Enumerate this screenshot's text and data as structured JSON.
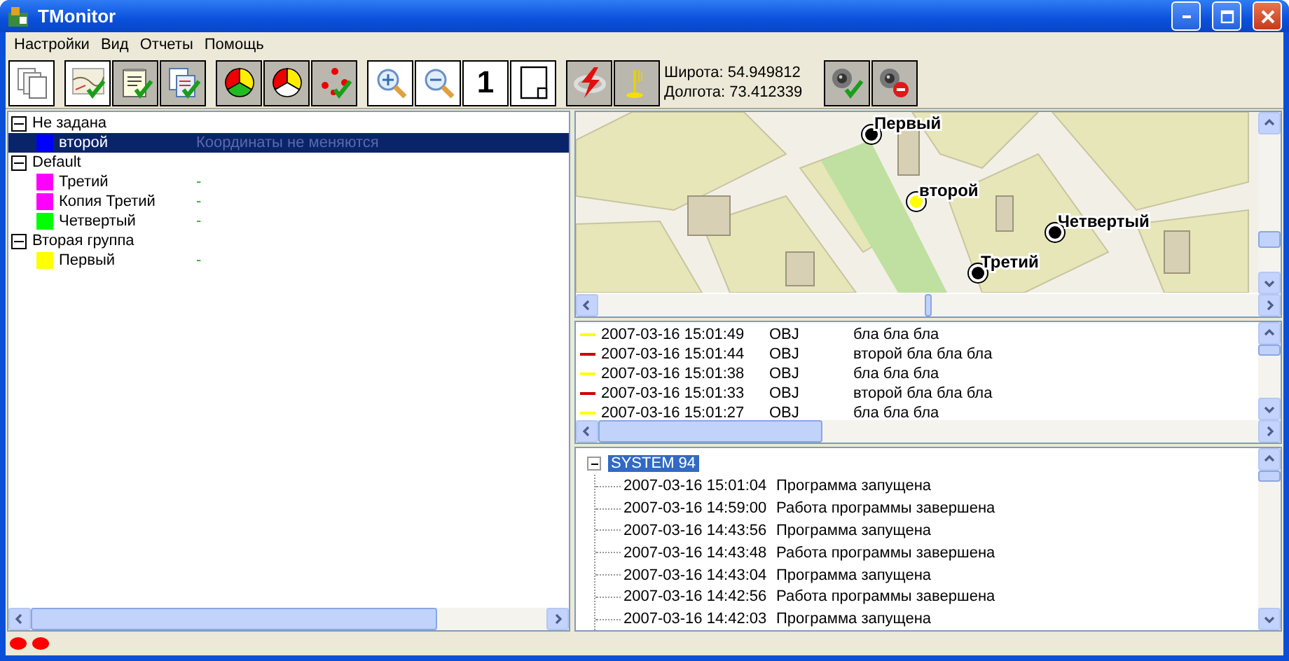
{
  "window": {
    "title": "TMonitor"
  },
  "menu": [
    "Настройки",
    "Вид",
    "Отчеты",
    "Помощь"
  ],
  "toolbar": [
    [
      {
        "kind": "copy",
        "pressed": false
      }
    ],
    [
      {
        "kind": "map-check",
        "pressed": false
      },
      {
        "kind": "notes-check",
        "pressed": true
      },
      {
        "kind": "docs-check",
        "pressed": true
      }
    ],
    [
      {
        "kind": "pie-green",
        "pressed": true
      },
      {
        "kind": "pie-white",
        "pressed": true
      },
      {
        "kind": "dots-check",
        "pressed": true
      }
    ],
    [
      {
        "kind": "zoom-in",
        "pressed": false
      },
      {
        "kind": "zoom-out",
        "pressed": false
      },
      {
        "kind": "number",
        "label": "1",
        "pressed": false
      },
      {
        "kind": "page",
        "pressed": false
      }
    ],
    [
      {
        "kind": "lightning",
        "pressed": true
      },
      {
        "kind": "antenna",
        "pressed": true
      },
      {
        "kind": "coords",
        "lines": [
          "Широта: 54.949812",
          "Долгота: 73.412339"
        ]
      }
    ],
    [
      {
        "kind": "camera-check",
        "pressed": true
      },
      {
        "kind": "camera-stop",
        "pressed": true
      }
    ]
  ],
  "objects_tree": [
    {
      "label": "Не задана",
      "expanded": true,
      "children": [
        {
          "label": "второй",
          "color": "#0000ff",
          "status": "Координаты не меняются",
          "selected": true
        }
      ]
    },
    {
      "label": "Default",
      "expanded": true,
      "children": [
        {
          "label": "Третий",
          "color": "#ff00ff",
          "status": "-",
          "selected": false
        },
        {
          "label": "Копия Третий",
          "color": "#ff00ff",
          "status": "-",
          "selected": false
        },
        {
          "label": "Четвертый",
          "color": "#00ff00",
          "status": "-",
          "selected": false
        }
      ]
    },
    {
      "label": "Вторая группа",
      "expanded": true,
      "children": [
        {
          "label": "Первый",
          "color": "#ffff00",
          "status": "-",
          "selected": false
        }
      ]
    }
  ],
  "map": {
    "markers": [
      {
        "label": "Первый",
        "color": "#000000"
      },
      {
        "label": "второй",
        "color": "#ffff00"
      },
      {
        "label": "Четвертый",
        "color": "#000000"
      },
      {
        "label": "Третий",
        "color": "#000000"
      }
    ]
  },
  "events": [
    {
      "color": "#ffff00",
      "time": "2007-03-16 15:01:49",
      "type": "OBJ",
      "text": "бла бла бла"
    },
    {
      "color": "#cc0000",
      "time": "2007-03-16 15:01:44",
      "type": "OBJ",
      "text": "второй бла бла бла"
    },
    {
      "color": "#ffff00",
      "time": "2007-03-16 15:01:38",
      "type": "OBJ",
      "text": "бла бла бла"
    },
    {
      "color": "#cc0000",
      "time": "2007-03-16 15:01:33",
      "type": "OBJ",
      "text": "второй бла бла бла"
    },
    {
      "color": "#ffff00",
      "time": "2007-03-16 15:01:27",
      "type": "OBJ",
      "text": "бла бла бла"
    }
  ],
  "log": {
    "label": "SYSTEM 94",
    "selected": true,
    "expanded": true,
    "children": [
      {
        "time": "2007-03-16 15:01:04",
        "message": "Программа запущена"
      },
      {
        "time": "2007-03-16 14:59:00",
        "message": "Работа программы завершена"
      },
      {
        "time": "2007-03-16 14:43:56",
        "message": "Программа запущена"
      },
      {
        "time": "2007-03-16 14:43:48",
        "message": "Работа программы завершена"
      },
      {
        "time": "2007-03-16 14:43:04",
        "message": "Программа запущена"
      },
      {
        "time": "2007-03-16 14:42:56",
        "message": "Работа программы завершена"
      },
      {
        "time": "2007-03-16 14:42:03",
        "message": "Программа запущена"
      }
    ]
  },
  "status_bar": {
    "indicators": [
      {
        "color": "#ff0000"
      },
      {
        "color": "#ff0000"
      }
    ]
  }
}
